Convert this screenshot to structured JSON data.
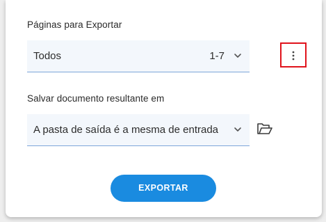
{
  "pages_section": {
    "label": "Páginas para Exportar",
    "select_value": "Todos",
    "range": "1-7"
  },
  "save_section": {
    "label": "Salvar documento resultante em",
    "select_value": "A pasta de saída é a mesma de entrada"
  },
  "buttons": {
    "export_label": "EXPORTAR"
  },
  "colors": {
    "accent": "#1a8be0",
    "highlight_border": "#e0121b",
    "select_background": "#f3f7fc",
    "select_underline": "#7da6d9"
  },
  "icons": {
    "pages_dropdown": "chevron-down-icon",
    "more": "more-vertical-icon",
    "folder_dropdown": "chevron-down-icon",
    "folder": "folder-open-icon"
  }
}
